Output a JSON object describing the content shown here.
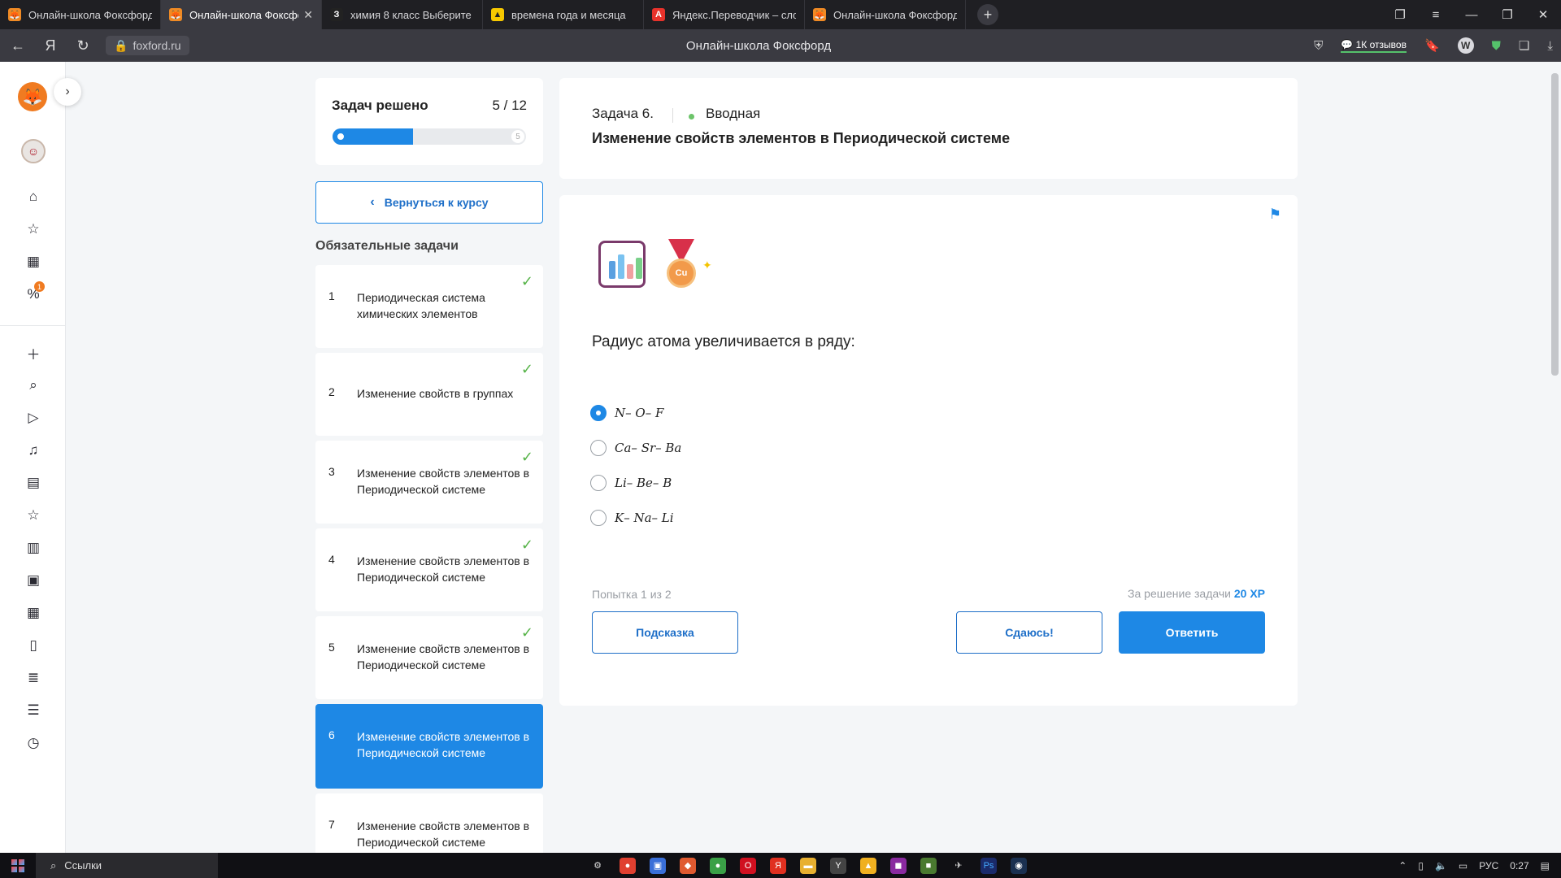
{
  "browser": {
    "tabs": [
      {
        "title": "Онлайн-школа Фоксфорд",
        "favicon": "fox-icon",
        "active": false
      },
      {
        "title": "Онлайн-школа Фоксфорд",
        "favicon": "fox-icon",
        "active": true
      },
      {
        "title": "химия 8 класс Выберите",
        "favicon": "z-icon",
        "favicon_text": "З",
        "active": false
      },
      {
        "title": "времена года и месяца",
        "favicon": "yandex-images-icon",
        "active": false
      },
      {
        "title": "Яндекс.Переводчик – сло",
        "favicon": "translate-icon",
        "favicon_text": "A",
        "active": false
      },
      {
        "title": "Онлайн-школа Фоксфорд",
        "favicon": "fox-icon",
        "active": false
      }
    ],
    "url": "foxford.ru",
    "page_title": "Онлайн-школа Фоксфорд",
    "reviews_label": "1К отзывов",
    "profile_letter": "W"
  },
  "rail": {
    "icons": [
      "home-icon",
      "star-icon",
      "calendar-icon",
      "percent-icon",
      "plus-icon",
      "search-icon",
      "play-icon",
      "headphones-icon",
      "chat-icon",
      "star-icon",
      "shop-icon",
      "book-icon",
      "grid-icon",
      "bookmark-icon",
      "notes-icon",
      "list-icon",
      "clock-icon"
    ],
    "badge": "1"
  },
  "progress": {
    "label": "Задач решено",
    "count": "5 / 12",
    "solved": 5,
    "total": 12,
    "end_marker": "5"
  },
  "back_button": "Вернуться к курсу",
  "tasks_heading": "Обязательные задачи",
  "tasks": [
    {
      "num": "1",
      "title": "Периодическая система химических элементов",
      "done": true,
      "active": false
    },
    {
      "num": "2",
      "title": "Изменение свойств в группах",
      "done": true,
      "active": false
    },
    {
      "num": "3",
      "title": "Изменение свойств элементов в Периодической системе",
      "done": true,
      "active": false
    },
    {
      "num": "4",
      "title": "Изменение свойств элементов в Периодической системе",
      "done": true,
      "active": false
    },
    {
      "num": "5",
      "title": "Изменение свойств элементов в Периодической системе",
      "done": true,
      "active": false
    },
    {
      "num": "6",
      "title": "Изменение свойств элементов в Периодической системе",
      "done": false,
      "active": true
    },
    {
      "num": "7",
      "title": "Изменение свойств элементов в Периодической системе",
      "done": false,
      "active": false
    }
  ],
  "task_header": {
    "task_label": "Задача 6.",
    "level": "Вводная",
    "title": "Изменение свойств элементов в Периодической системе"
  },
  "question": {
    "text": "Радиус атома увеличивается в ряду:",
    "medal_label": "Cu",
    "options": [
      {
        "label": "N– O– F",
        "selected": true
      },
      {
        "label": "Ca– Sr– Ba",
        "selected": false
      },
      {
        "label": "Li– Be– B",
        "selected": false
      },
      {
        "label": "K– Na– Li",
        "selected": false
      }
    ],
    "attempt": "Попытка 1 из 2",
    "reward_prefix": "За решение задачи",
    "reward_value": "20 XP",
    "hint_button": "Подсказка",
    "give_up_button": "Сдаюсь!",
    "answer_button": "Ответить"
  },
  "taskbar": {
    "search_label": "Ссылки",
    "language": "РУС",
    "time": "0:27"
  },
  "colors": {
    "accent": "#1e88e5",
    "success": "#55b347",
    "brand": "#f07b21"
  }
}
